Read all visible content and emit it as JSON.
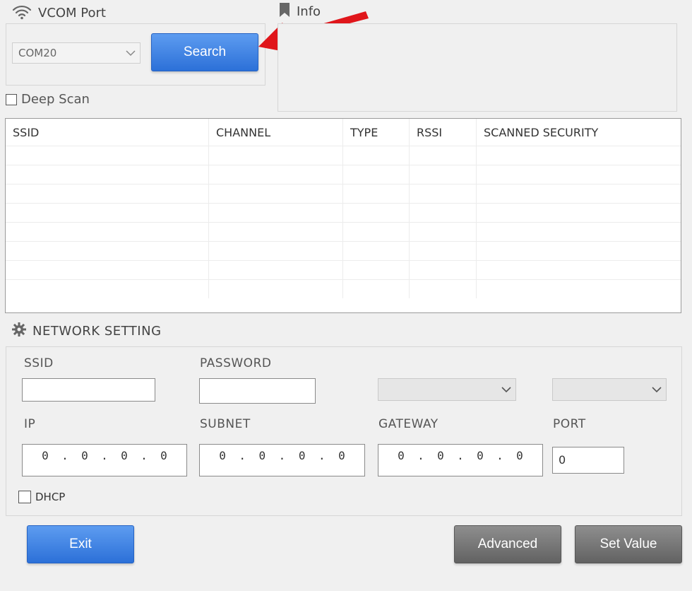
{
  "vcom": {
    "title": "VCOM Port",
    "port_value": "COM20",
    "search_label": "Search",
    "deep_scan_label": "Deep Scan",
    "deep_scan_checked": false
  },
  "info": {
    "title": "Info"
  },
  "scan_table": {
    "columns": [
      "SSID",
      "CHANNEL",
      "TYPE",
      "RSSI",
      "SCANNED SECURITY"
    ],
    "rows": []
  },
  "network": {
    "title": "NETWORK SETTING",
    "ssid_label": "SSID",
    "ssid_value": "",
    "password_label": "PASSWORD",
    "password_value": "",
    "ip_label": "IP",
    "ip_value": [
      "0",
      "0",
      "0",
      "0"
    ],
    "subnet_label": "SUBNET",
    "subnet_value": [
      "0",
      "0",
      "0",
      "0"
    ],
    "gateway_label": "GATEWAY",
    "gateway_value": [
      "0",
      "0",
      "0",
      "0"
    ],
    "port_label": "PORT",
    "port_value": "0",
    "dhcp_label": "DHCP",
    "dhcp_checked": false
  },
  "buttons": {
    "exit_label": "Exit",
    "advanced_label": "Advanced",
    "set_value_label": "Set Value"
  },
  "colors": {
    "accent_blue": "#2c70d8",
    "arrow_red": "#e0161b",
    "button_gray": "#6b6b6b",
    "background": "#f0f0f0"
  }
}
